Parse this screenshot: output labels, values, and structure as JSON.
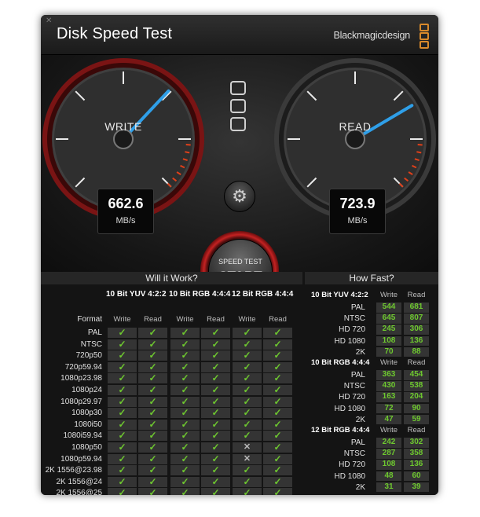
{
  "window": {
    "close_glyph": "✕",
    "title": "Disk Speed Test",
    "brand": "Blackmagicdesign"
  },
  "write_gauge": {
    "label": "WRITE",
    "value": "662.6",
    "unit": "MB/s",
    "needle_level": 0.66
  },
  "read_gauge": {
    "label": "READ",
    "value": "723.9",
    "unit": "MB/s",
    "needle_level": 0.72
  },
  "controls": {
    "settings_glyph": "⚙",
    "start_small": "SPEED TEST",
    "start_big": "START"
  },
  "will_it_work": {
    "heading": "Will it Work?",
    "format_label": "Format",
    "groups": [
      "10 Bit YUV 4:2:2",
      "10 Bit RGB 4:4:4",
      "12 Bit RGB 4:4:4"
    ],
    "sub_write": "Write",
    "sub_read": "Read",
    "rows": [
      {
        "name": "PAL",
        "results": [
          true,
          true,
          true,
          true,
          true,
          true
        ]
      },
      {
        "name": "NTSC",
        "results": [
          true,
          true,
          true,
          true,
          true,
          true
        ]
      },
      {
        "name": "720p50",
        "results": [
          true,
          true,
          true,
          true,
          true,
          true
        ]
      },
      {
        "name": "720p59.94",
        "results": [
          true,
          true,
          true,
          true,
          true,
          true
        ]
      },
      {
        "name": "1080p23.98",
        "results": [
          true,
          true,
          true,
          true,
          true,
          true
        ]
      },
      {
        "name": "1080p24",
        "results": [
          true,
          true,
          true,
          true,
          true,
          true
        ]
      },
      {
        "name": "1080p29.97",
        "results": [
          true,
          true,
          true,
          true,
          true,
          true
        ]
      },
      {
        "name": "1080p30",
        "results": [
          true,
          true,
          true,
          true,
          true,
          true
        ]
      },
      {
        "name": "1080i50",
        "results": [
          true,
          true,
          true,
          true,
          true,
          true
        ]
      },
      {
        "name": "1080i59.94",
        "results": [
          true,
          true,
          true,
          true,
          true,
          true
        ]
      },
      {
        "name": "1080p50",
        "results": [
          true,
          true,
          true,
          true,
          false,
          true
        ]
      },
      {
        "name": "1080p59.94",
        "results": [
          true,
          true,
          true,
          true,
          false,
          true
        ]
      },
      {
        "name": "2K 1556@23.98",
        "results": [
          true,
          true,
          true,
          true,
          true,
          true
        ]
      },
      {
        "name": "2K 1556@24",
        "results": [
          true,
          true,
          true,
          true,
          true,
          true
        ]
      },
      {
        "name": "2K 1556@25",
        "results": [
          true,
          true,
          true,
          true,
          true,
          true
        ]
      }
    ],
    "check_glyph": "✓",
    "cross_glyph": "✕"
  },
  "how_fast": {
    "heading": "How Fast?",
    "sub_write": "Write",
    "sub_read": "Read",
    "groups": [
      {
        "name": "10 Bit YUV 4:2:2",
        "rows": [
          {
            "name": "PAL",
            "write": "544",
            "read": "681"
          },
          {
            "name": "NTSC",
            "write": "645",
            "read": "807"
          },
          {
            "name": "HD 720",
            "write": "245",
            "read": "306"
          },
          {
            "name": "HD 1080",
            "write": "108",
            "read": "136"
          },
          {
            "name": "2K",
            "write": "70",
            "read": "88"
          }
        ]
      },
      {
        "name": "10 Bit RGB 4:4:4",
        "rows": [
          {
            "name": "PAL",
            "write": "363",
            "read": "454"
          },
          {
            "name": "NTSC",
            "write": "430",
            "read": "538"
          },
          {
            "name": "HD 720",
            "write": "163",
            "read": "204"
          },
          {
            "name": "HD 1080",
            "write": "72",
            "read": "90"
          },
          {
            "name": "2K",
            "write": "47",
            "read": "59"
          }
        ]
      },
      {
        "name": "12 Bit RGB 4:4:4",
        "rows": [
          {
            "name": "PAL",
            "write": "242",
            "read": "302"
          },
          {
            "name": "NTSC",
            "write": "287",
            "read": "358"
          },
          {
            "name": "HD 720",
            "write": "108",
            "read": "136"
          },
          {
            "name": "HD 1080",
            "write": "48",
            "read": "60"
          },
          {
            "name": "2K",
            "write": "31",
            "read": "39"
          }
        ]
      }
    ]
  },
  "colors": {
    "accent_red": "#c42222",
    "needle_blue": "#2f9fe8",
    "ok_green": "#6ec82f",
    "brand_orange": "#d98a2b"
  }
}
